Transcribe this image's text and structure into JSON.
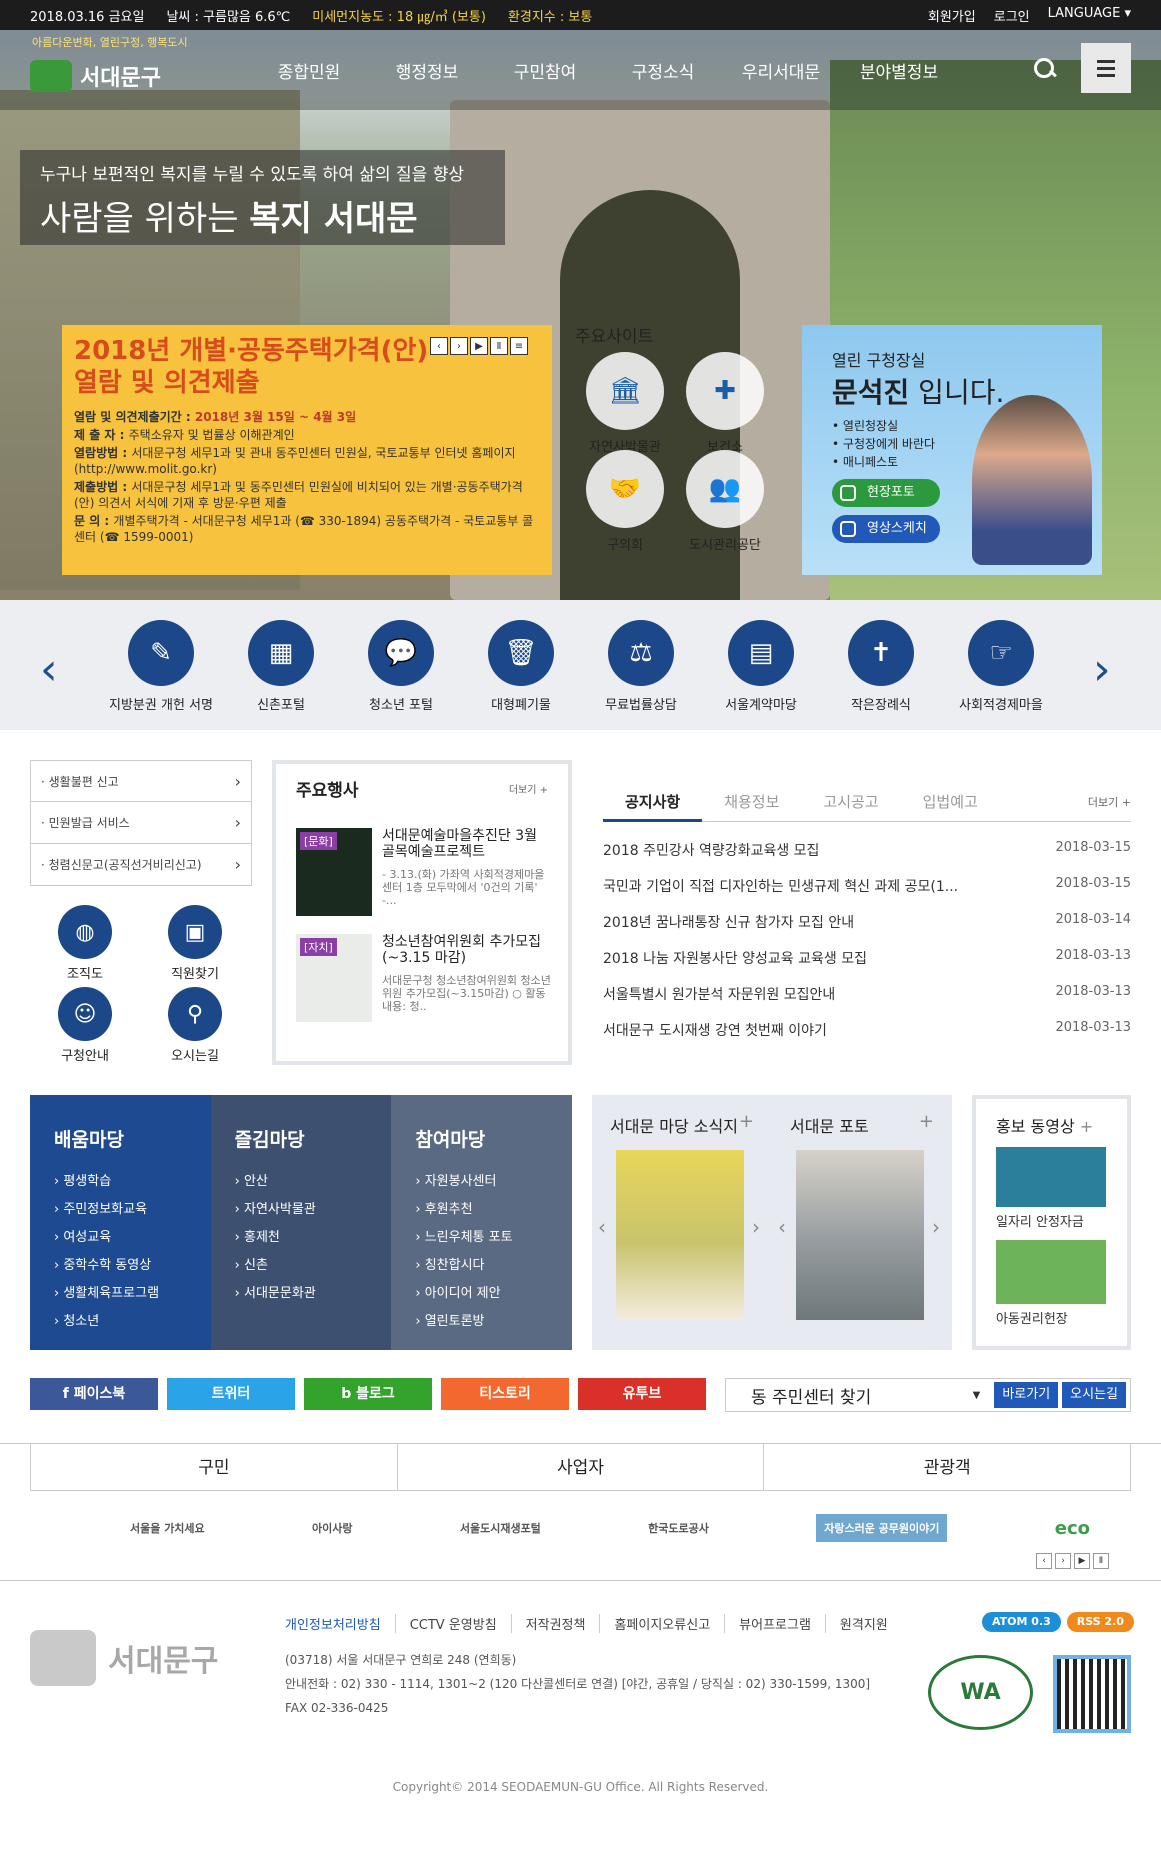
{
  "topbar": {
    "date": "2018.03.16 금요일",
    "weather": "날씨 : 구름많음 6.6℃",
    "dust": "미세먼지농도 : 18 ㎍/㎥ (보통)",
    "env": "환경지수 : 보통",
    "join": "회원가입",
    "login": "로그인",
    "language": "LANGUAGE"
  },
  "header": {
    "tagline": "아름다운변화, 열린구정, 행복도시",
    "logo": "서대문구",
    "menu": [
      "종합민원",
      "행정정보",
      "구민참여",
      "구정소식",
      "우리서대문",
      "분야별정보"
    ]
  },
  "hero": {
    "line1": "누구나 보편적인 복지를 누릴 수 있도록 하여 삶의 질을 향상",
    "line2a": "사람을 위하는 ",
    "line2b": "복지 서대문"
  },
  "slide": {
    "title1": "2018년 개별·공동주택가격(안)",
    "title2": "열람 및 의견제출",
    "rows": [
      {
        "k": "열람 및 의견제출기간 : ",
        "v": "2018년 3월 15일 ~ 4월 3일",
        "red": true
      },
      {
        "k": "제 출 자 : ",
        "v": "주택소유자 및 법률상 이해관계인"
      },
      {
        "k": "열람방법 : ",
        "v": "서대문구청 세무1과 및 관내 동주민센터 민원실, 국토교통부 인터넷 홈페이지(http://www.molit.go.kr)"
      },
      {
        "k": "제출방법 : ",
        "v": "서대문구청 세무1과 및 동주민센터 민원실에 비치되어 있는 개별·공동주택가격(안) 의견서 서식에 기재 후 방문·우편 제출"
      },
      {
        "k": "문    의 : ",
        "v": "개별주택가격 - 서대문구청 세무1과 (☎ 330-1894) 공동주택가격 - 국토교통부 콜센터 (☎ 1599-0001)"
      }
    ],
    "controls": [
      "‹",
      "›",
      "▶",
      "Ⅱ",
      "≡"
    ]
  },
  "sites": {
    "title": "주요사이트",
    "items": [
      "자연사박물관",
      "보건소",
      "구의회",
      "도시관리공단"
    ]
  },
  "mayor": {
    "label": "열린 구청장실",
    "name": "문석진",
    "suffix": " 입니다.",
    "links": [
      "열린청장실",
      "구청장에게 바란다",
      "매니페스토"
    ],
    "btn1": "현장포토",
    "btn2": "영상스케치"
  },
  "quick": {
    "items": [
      "지방분권 개헌 서명",
      "신촌포털",
      "청소년 포털",
      "대형폐기물",
      "무료법률상담",
      "서울계약마당",
      "작은장례식",
      "사회적경제마을"
    ],
    "prev": "‹",
    "next": "›"
  },
  "side": {
    "links": [
      "· 생활불편 신고",
      "· 민원발급 서비스",
      "· 청렴신문고(공직선거비리신고)"
    ],
    "icons": [
      "조직도",
      "직원찾기",
      "구청안내",
      "오시는길"
    ]
  },
  "events": {
    "title": "주요행사",
    "more": "더보기 +",
    "items": [
      {
        "tag": "[문화]",
        "title": "서대문예술마을추진단 3월 골목예술프로젝트",
        "desc": "- 3.13.(화) 가좌역 사회적경제마을센터 1층 모두막에서 '0건의 기록' -..."
      },
      {
        "tag": "[자치]",
        "title": "청소년참여위원회 추가모집(~3.15 마감)",
        "desc": "서대문구청 청소년참여위원회 청소년위원 추가모집(~3.15마감) ○ 활동내용: 청.."
      }
    ]
  },
  "notice": {
    "tabs": [
      "공지사항",
      "채용정보",
      "고시공고",
      "입법예고"
    ],
    "more": "더보기 +",
    "items": [
      {
        "t": "2018 주민강사 역량강화교육생 모집",
        "d": "2018-03-15"
      },
      {
        "t": "국민과 기업이 직접 디자인하는 민생규제 혁신 과제 공모(1...",
        "d": "2018-03-15"
      },
      {
        "t": "2018년 꿈나래통장 신규 참가자 모집 안내",
        "d": "2018-03-14"
      },
      {
        "t": "2018 나눔 자원봉사단 양성교육 교육생 모집",
        "d": "2018-03-13"
      },
      {
        "t": "서울특별시 원가분석 자문위원 모집안내",
        "d": "2018-03-13"
      },
      {
        "t": "서대문구 도시재생 강연 첫번째 이야기",
        "d": "2018-03-13"
      }
    ]
  },
  "madang": [
    {
      "title": "배움마당",
      "items": [
        "평생학습",
        "주민정보화교육",
        "여성교육",
        "중학수학 동영상",
        "생활체육프로그램",
        "청소년"
      ],
      "color": "#1d4a90"
    },
    {
      "title": "즐김마당",
      "items": [
        "안산",
        "자연사박물관",
        "홍제천",
        "신촌",
        "서대문문화관"
      ],
      "color": "#3e5070"
    },
    {
      "title": "참여마당",
      "items": [
        "자원봉사센터",
        "후원추천",
        "느린우체통 포토",
        "칭찬합시다",
        "아이디어 제안",
        "열린토론방"
      ],
      "color": "#5a6a82"
    }
  ],
  "news": {
    "b1": "서대문 마당 소식지",
    "b2": "서대문 포토",
    "plus": "+",
    "prev": "‹",
    "next": "›"
  },
  "promo": {
    "title": "홍보 동영상",
    "plus": "+",
    "cap1": "일자리 안정자금",
    "cap2": "아동권리헌장"
  },
  "sns": [
    {
      "l": "f  페이스북",
      "c": "#3b5998"
    },
    {
      "l": "트위터",
      "c": "#2aa3e8"
    },
    {
      "l": "b  블로그",
      "c": "#33a32c"
    },
    {
      "l": "티스토리",
      "c": "#f2682e"
    },
    {
      "l": "유투브",
      "c": "#d9302a"
    }
  ],
  "center": {
    "select": "동 주민센터 찾기",
    "btn1": "바로가기",
    "btn2": "오시는길"
  },
  "target": [
    "구민",
    "사업자",
    "관광객"
  ],
  "banners": [
    "서울을 가치세요",
    "아이사랑",
    "서울도시재생포털",
    "한국도로공사",
    "자랑스러운 공무원이야기",
    "eco"
  ],
  "bctl": [
    "‹",
    "›",
    "▶",
    "Ⅱ"
  ],
  "footer": {
    "logo": "서대문구",
    "links": [
      "개인정보처리방침",
      "CCTV 운영방침",
      "저작권정책",
      "홈페이지오류신고",
      "뷰어프로그램",
      "원격지원"
    ],
    "atom": "ATOM 0.3",
    "rss": "RSS 2.0",
    "addr": "(03718) 서울 서대문구 연희로 248 (연희동)",
    "tel": "안내전화 : 02) 330 - 1114, 1301~2 (120 다산콜센터로 연결) [야간, 공휴일 / 당직실 : 02) 330-1599, 1300]",
    "fax": "FAX 02-336-0425",
    "wa": "WA",
    "copy": "Copyright© 2014 SEODAEMUN-GU Office. All Rights Reserved."
  }
}
